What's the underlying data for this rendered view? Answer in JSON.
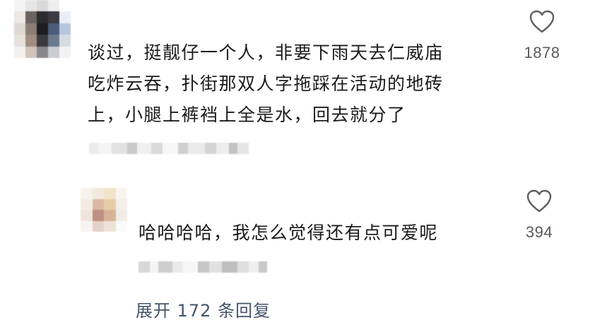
{
  "comment": {
    "lines": [
      "谈过，挺靓仔一个人，非要下雨天去仁威庙",
      "吃炸云吞，扑街那双人字拖踩在活动的地砖",
      "上，小腿上裤裆上全是水，回去就分了"
    ],
    "likes": "1878"
  },
  "reply": {
    "text": "哈哈哈哈，我怎么觉得还有点可爱呢",
    "likes": "394"
  },
  "expand_replies": "展开 172 条回复",
  "icons": {
    "like": "heart-outline-icon"
  },
  "colors": {
    "text": "#1b1b1b",
    "muted": "#6a6a6a",
    "link": "#44546b"
  }
}
